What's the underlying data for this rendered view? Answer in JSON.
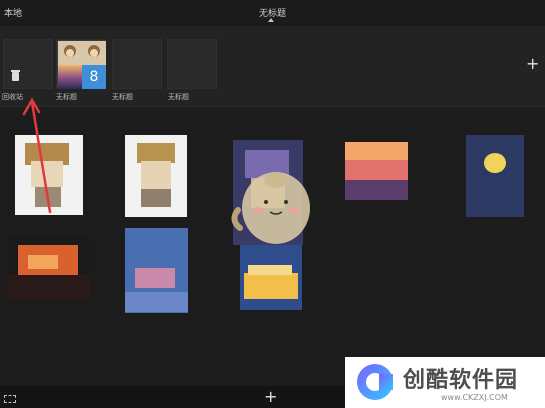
{
  "header": {
    "left_label": "本地",
    "title": "无标题"
  },
  "albums": [
    {
      "label": "回收站",
      "icon": "trash-icon"
    },
    {
      "label": "无标题",
      "icon": "thumbnail-quad"
    },
    {
      "label": "无标题"
    },
    {
      "label": "无标题"
    }
  ],
  "albums_add_label": "+",
  "bottom": {
    "add_label": "+",
    "select_icon": "select-icon"
  },
  "quad_badge": "8",
  "watermark": {
    "title": "创酷软件园",
    "url": "www.CKZXJ.COM"
  },
  "colors": {
    "background": "#1c1c1c",
    "arrow": "#e0393e",
    "watermark_bg": "#ffffff"
  }
}
